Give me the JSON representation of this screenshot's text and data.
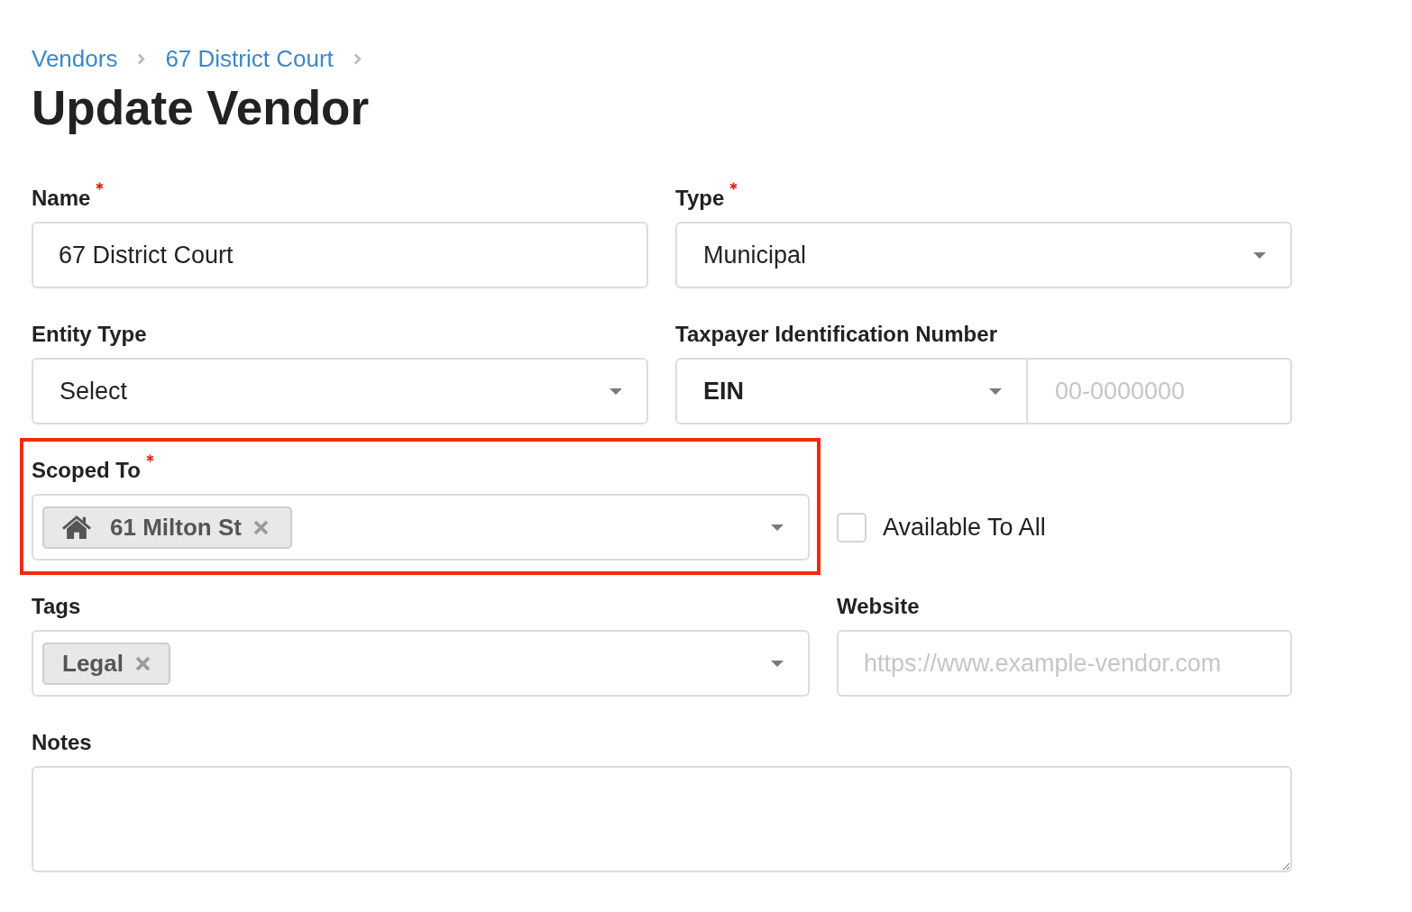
{
  "breadcrumb": [
    {
      "label": "Vendors"
    },
    {
      "label": "67 District Court"
    }
  ],
  "title": "Update Vendor",
  "rows": [
    {
      "fields": [
        {
          "kind": "text",
          "label": "Name",
          "required": true,
          "highlighted": false,
          "value": "67 District Court"
        },
        {
          "kind": "select",
          "label": "Type",
          "required": true,
          "highlighted": false,
          "value": "Municipal"
        }
      ]
    },
    {
      "fields": [
        {
          "kind": "select",
          "label": "Entity Type",
          "required": false,
          "highlighted": false,
          "value": "Select"
        },
        {
          "kind": "tin",
          "label": "Taxpayer Identification Number",
          "required": false,
          "highlighted": false,
          "id_type": "EIN",
          "placeholder": "00-0000000"
        }
      ]
    },
    {
      "fields": [
        {
          "kind": "multiselect",
          "label": "Scoped To",
          "required": true,
          "highlighted": true,
          "chips": [
            {
              "kind": "property",
              "label": "61 Milton St"
            }
          ]
        },
        {
          "kind": "checkbox",
          "label": "Available To All",
          "highlighted": false,
          "checked": false
        }
      ]
    },
    {
      "fields": [
        {
          "kind": "multiselect",
          "label": "Tags",
          "required": false,
          "highlighted": false,
          "chips": [
            {
              "kind": "tag",
              "label": "Legal"
            }
          ]
        },
        {
          "kind": "text",
          "label": "Website",
          "required": false,
          "highlighted": false,
          "placeholder": "https://www.example-vendor.com"
        }
      ]
    },
    {
      "fields": [
        {
          "kind": "textarea",
          "label": "Notes",
          "required": false,
          "highlighted": false
        }
      ]
    }
  ]
}
